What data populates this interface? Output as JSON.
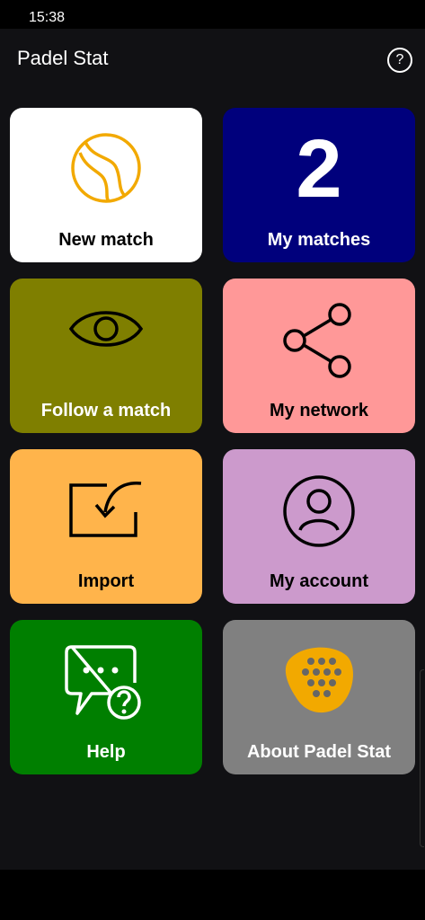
{
  "status_bar": {
    "time": "15:38"
  },
  "app_bar": {
    "title": "Padel Stat",
    "help_icon": "help-circle-icon",
    "help_glyph": "?"
  },
  "tiles": [
    {
      "label": "New match",
      "bg": "#ffffff",
      "fg": "#000000",
      "icon": "tennis-ball-icon"
    },
    {
      "label": "My matches",
      "bg": "#00007c",
      "fg": "#ffffff",
      "icon": "count",
      "count": "2"
    },
    {
      "label": "Follow a match",
      "bg": "#7f7f00",
      "fg": "#ffffff",
      "icon": "eye-icon"
    },
    {
      "label": "My network",
      "bg": "#ff9898",
      "fg": "#000000",
      "icon": "share-icon"
    },
    {
      "label": "Import",
      "bg": "#ffb44b",
      "fg": "#000000",
      "icon": "import-icon"
    },
    {
      "label": "My account",
      "bg": "#cc9acc",
      "fg": "#000000",
      "icon": "account-icon"
    },
    {
      "label": "Help",
      "bg": "#007f00",
      "fg": "#ffffff",
      "icon": "chat-help-icon"
    },
    {
      "label": "About Padel Stat",
      "bg": "#808080",
      "fg": "#ffffff",
      "icon": "padel-racket-logo"
    }
  ],
  "colors": {
    "ball_orange": "#f2a900",
    "background": "#111114"
  }
}
